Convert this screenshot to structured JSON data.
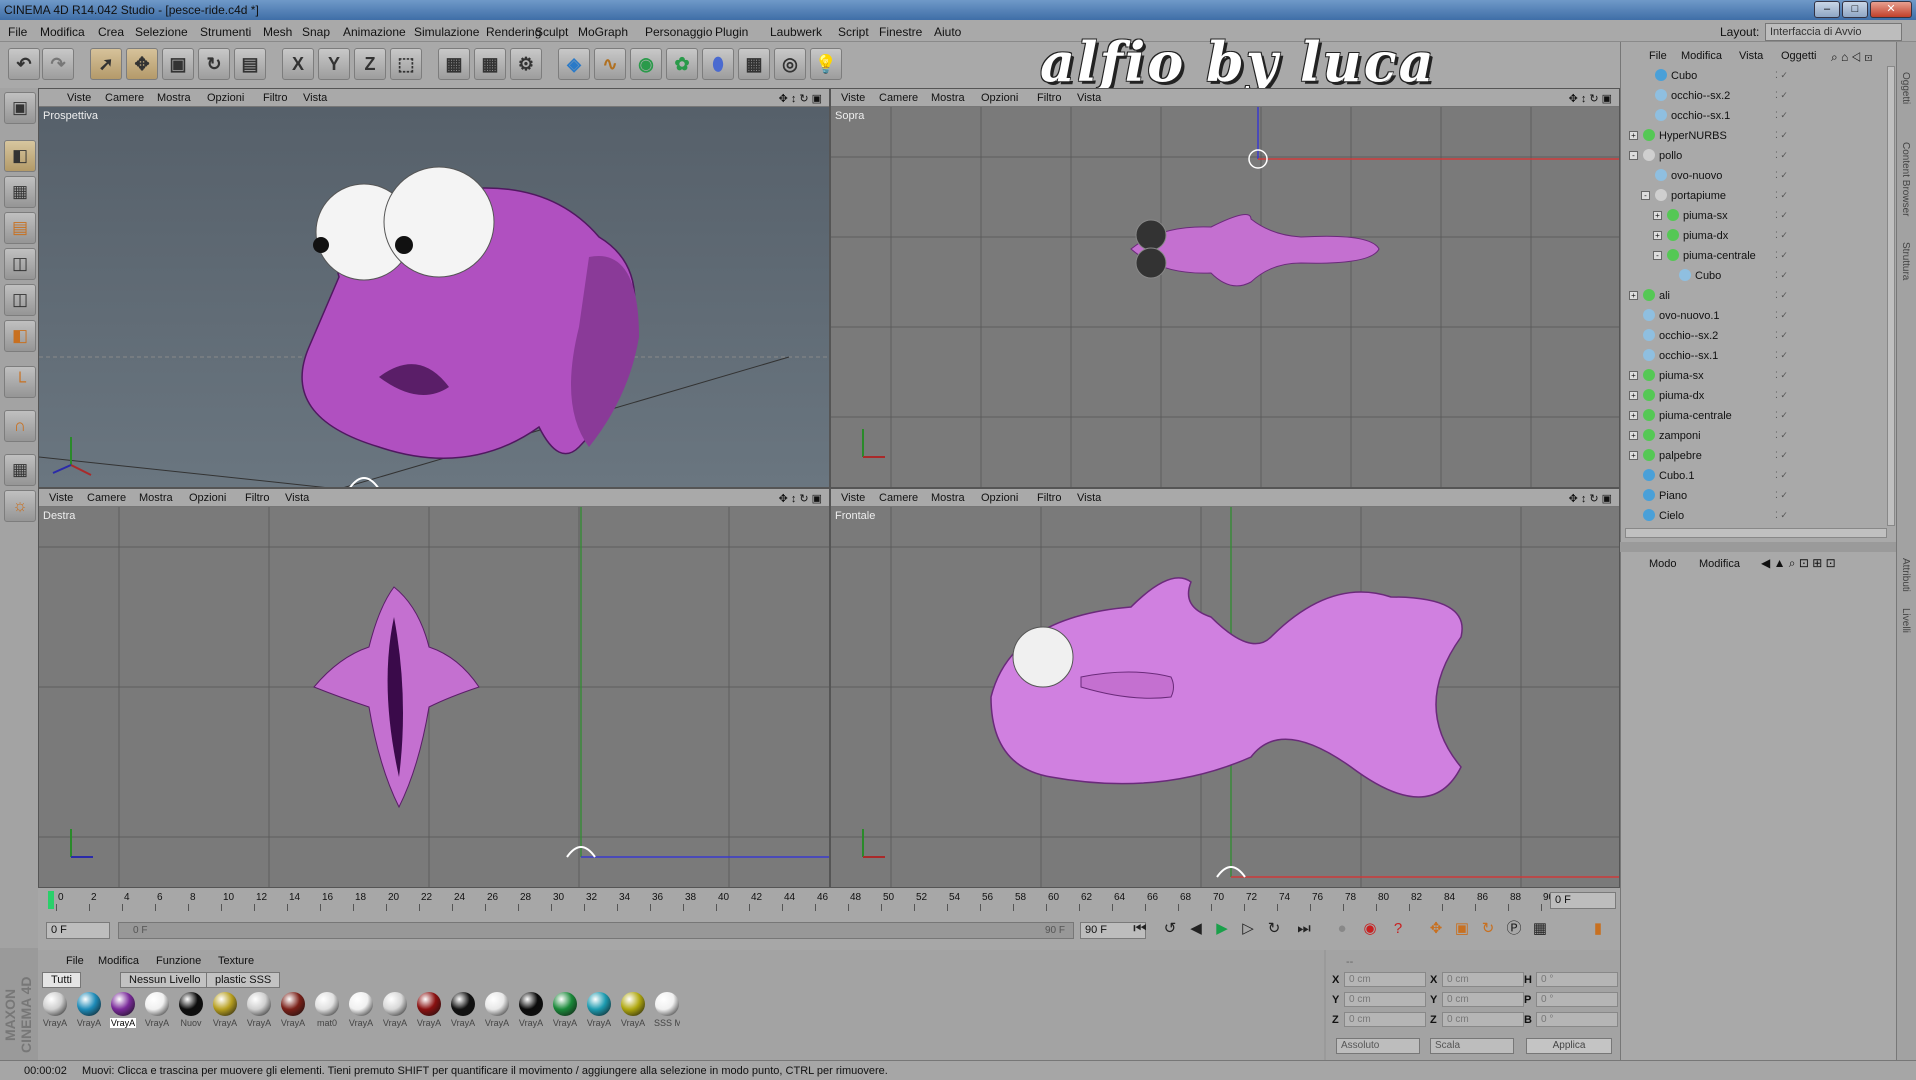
{
  "window": {
    "title": "CINEMA 4D R14.042 Studio - [pesce-ride.c4d *]"
  },
  "menubar": [
    "File",
    "Modifica",
    "Crea",
    "Selezione",
    "Strumenti",
    "Mesh",
    "Snap",
    "Animazione",
    "Simulazione",
    "Rendering",
    "Sculpt",
    "MoGraph",
    "Personaggio",
    "Plugin",
    "Laubwerk",
    "Script",
    "Finestre",
    "Aiuto"
  ],
  "overlay_title": "alfio by luca",
  "layout": {
    "label": "Layout:",
    "value": "Interfaccia di Avvio"
  },
  "viewport_menu": [
    "Viste",
    "Camere",
    "Mostra",
    "Opzioni",
    "Filtro",
    "Vista"
  ],
  "viewports": [
    {
      "label": "Prospettiva"
    },
    {
      "label": "Sopra"
    },
    {
      "label": "Destra"
    },
    {
      "label": "Frontale"
    }
  ],
  "timeline": {
    "ticks": [
      "0",
      "2",
      "4",
      "6",
      "8",
      "10",
      "12",
      "14",
      "16",
      "18",
      "20",
      "22",
      "24",
      "26",
      "28",
      "30",
      "32",
      "34",
      "36",
      "38",
      "40",
      "42",
      "44",
      "46",
      "48",
      "50",
      "52",
      "54",
      "56",
      "58",
      "60",
      "62",
      "64",
      "66",
      "68",
      "70",
      "72",
      "74",
      "76",
      "78",
      "80",
      "82",
      "84",
      "86",
      "88",
      "90"
    ],
    "current": "0 F",
    "start": "0 F",
    "slider_start": "0 F",
    "slider_end": "90 F",
    "end": "90 F"
  },
  "material_manager": {
    "menu": [
      "File",
      "Modifica",
      "Funzione",
      "Texture"
    ],
    "tabs": [
      "Tutti",
      "Nessun Livello",
      "plastic SSS"
    ],
    "materials": [
      {
        "label": "VrayA",
        "color": "#cfcfcf"
      },
      {
        "label": "VrayA",
        "color": "#1e8bb8"
      },
      {
        "label": "VrayA",
        "color": "#7a2a9a"
      },
      {
        "label": "VrayA",
        "color": "#f0f0f0"
      },
      {
        "label": "Nuov",
        "color": "#0d0d0d"
      },
      {
        "label": "VrayA",
        "color": "#b8a020"
      },
      {
        "label": "VrayA",
        "color": "#cfcfcf"
      },
      {
        "label": "VrayA",
        "color": "#7a2018"
      },
      {
        "label": "mat0",
        "color": "#e0e0e0"
      },
      {
        "label": "VrayA",
        "color": "#f0f0f0"
      },
      {
        "label": "VrayA",
        "color": "#d8d8d8"
      },
      {
        "label": "VrayA",
        "color": "#8a1010"
      },
      {
        "label": "VrayA",
        "color": "#111111"
      },
      {
        "label": "VrayA",
        "color": "#e8e8e8"
      },
      {
        "label": "VrayA",
        "color": "#0a0a0a"
      },
      {
        "label": "VrayA",
        "color": "#1b8a3a"
      },
      {
        "label": "VrayA",
        "color": "#1d9bb0"
      },
      {
        "label": "VrayA",
        "color": "#b0a810"
      },
      {
        "label": "SSS M",
        "color": "#f0f0f0"
      }
    ]
  },
  "coordinates": {
    "header": "--",
    "rows": [
      {
        "a": "X",
        "av": "0 cm",
        "b": "X",
        "bv": "0 cm",
        "c": "H",
        "cv": "0 °"
      },
      {
        "a": "Y",
        "av": "0 cm",
        "b": "Y",
        "bv": "0 cm",
        "c": "P",
        "cv": "0 °"
      },
      {
        "a": "Z",
        "av": "0 cm",
        "b": "Z",
        "bv": "0 cm",
        "c": "B",
        "cv": "0 °"
      }
    ],
    "mode1": "Assoluto",
    "mode2": "Scala",
    "apply": "Applica"
  },
  "object_manager": {
    "menu": [
      "File",
      "Modifica",
      "Vista",
      "Oggetti"
    ],
    "objects": [
      {
        "name": "Cubo",
        "indent": 1,
        "icon": "#4aa0d8",
        "exp": ""
      },
      {
        "name": "occhio--sx.2",
        "indent": 1,
        "icon": "#8fbfe0",
        "exp": ""
      },
      {
        "name": "occhio--sx.1",
        "indent": 1,
        "icon": "#8fbfe0",
        "exp": ""
      },
      {
        "name": "HyperNURBS",
        "indent": 0,
        "icon": "#55c855",
        "exp": "+"
      },
      {
        "name": "pollo",
        "indent": 0,
        "icon": "#cfcfcf",
        "exp": "-"
      },
      {
        "name": "ovo-nuovo",
        "indent": 1,
        "icon": "#8fbfe0",
        "exp": ""
      },
      {
        "name": "portapiume",
        "indent": 1,
        "icon": "#cfcfcf",
        "exp": "-"
      },
      {
        "name": "piuma-sx",
        "indent": 2,
        "icon": "#55c855",
        "exp": "+"
      },
      {
        "name": "piuma-dx",
        "indent": 2,
        "icon": "#55c855",
        "exp": "+"
      },
      {
        "name": "piuma-centrale",
        "indent": 2,
        "icon": "#55c855",
        "exp": "-"
      },
      {
        "name": "Cubo",
        "indent": 3,
        "icon": "#8fbfe0",
        "exp": ""
      },
      {
        "name": "ali",
        "indent": 0,
        "icon": "#55c855",
        "exp": "+"
      },
      {
        "name": "ovo-nuovo.1",
        "indent": 0,
        "icon": "#8fbfe0",
        "exp": ""
      },
      {
        "name": "occhio--sx.2",
        "indent": 0,
        "icon": "#8fbfe0",
        "exp": ""
      },
      {
        "name": "occhio--sx.1",
        "indent": 0,
        "icon": "#8fbfe0",
        "exp": ""
      },
      {
        "name": "piuma-sx",
        "indent": 0,
        "icon": "#55c855",
        "exp": "+"
      },
      {
        "name": "piuma-dx",
        "indent": 0,
        "icon": "#55c855",
        "exp": "+"
      },
      {
        "name": "piuma-centrale",
        "indent": 0,
        "icon": "#55c855",
        "exp": "+"
      },
      {
        "name": "zamponi",
        "indent": 0,
        "icon": "#55c855",
        "exp": "+"
      },
      {
        "name": "palpebre",
        "indent": 0,
        "icon": "#55c855",
        "exp": "+"
      },
      {
        "name": "Cubo.1",
        "indent": 0,
        "icon": "#4aa0d8",
        "exp": ""
      },
      {
        "name": "Piano",
        "indent": 0,
        "icon": "#4aa0d8",
        "exp": ""
      },
      {
        "name": "Cielo",
        "indent": 0,
        "icon": "#4aa0d8",
        "exp": ""
      }
    ]
  },
  "attribute_manager": {
    "menu": [
      "Modo",
      "Modifica"
    ]
  },
  "side_tabs": [
    "Oggetti",
    "Content Browser",
    "Struttura",
    "Attributi",
    "Livelli"
  ],
  "status": {
    "time": "00:00:02",
    "message": "Muovi: Clicca e trascina per muovere gli elementi. Tieni premuto SHIFT per quantificare il movimento / aggiungere alla selezione in modo punto, CTRL per rimuovere."
  },
  "maxon": "MAXON CINEMA 4D",
  "colors": {
    "accent": "#d088e0",
    "wire": "#a060b0",
    "grid": "#555555"
  }
}
